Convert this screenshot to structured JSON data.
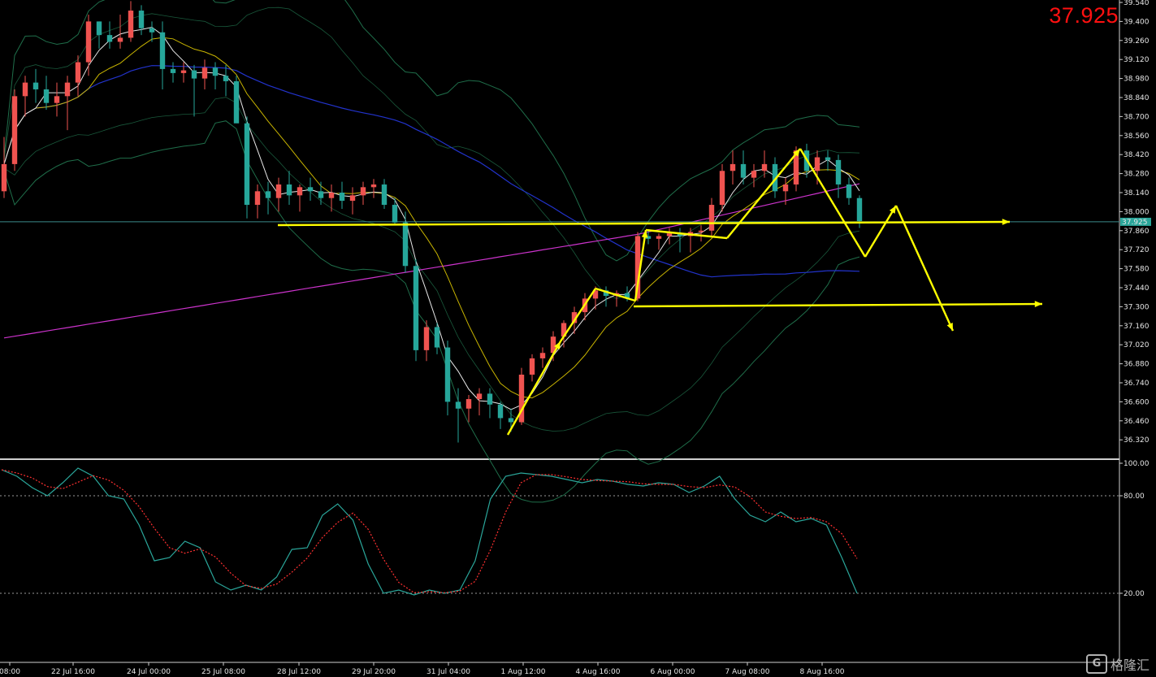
{
  "current_price": "37.925",
  "price_tag": "37.925",
  "watermark_text": "格隆汇",
  "watermark_logo": "G",
  "colors": {
    "bull": "#ef5350",
    "bear": "#26a69a",
    "annotation": "#ffff00",
    "bollinger": "#1f6e4a",
    "ma_fast": "#e8e8e8",
    "ma_slow": "#c8b400",
    "ma_blue": "#2233cc",
    "ma_magenta": "#cc33cc",
    "stoch_k": "#2aa69a",
    "stoch_d": "#ff3030"
  },
  "chart_data": [
    {
      "type": "candlestick",
      "y_ticks": [
        "39.540",
        "39.400",
        "39.260",
        "39.120",
        "38.980",
        "38.840",
        "38.700",
        "38.560",
        "38.420",
        "38.280",
        "38.140",
        "38.000",
        "37.860",
        "37.720",
        "37.580",
        "37.440",
        "37.300",
        "37.160",
        "37.020",
        "36.880",
        "36.740",
        "36.600",
        "36.460",
        "36.320"
      ],
      "ylim": [
        36.2,
        39.55
      ],
      "x_ticks": [
        "08:00",
        "22 Jul 16:00",
        "24 Jul 00:00",
        "25 Jul 08:00",
        "28 Jul 12:00",
        "29 Jul 20:00",
        "31 Jul 04:00",
        "1 Aug 12:00",
        "4 Aug 16:00",
        "6 Aug 00:00",
        "7 Aug 08:00",
        "8 Aug 16:00"
      ],
      "ohlc": [
        [
          38.15,
          38.55,
          38.1,
          38.35
        ],
        [
          38.35,
          38.9,
          38.3,
          38.85
        ],
        [
          38.85,
          39.0,
          38.7,
          38.95
        ],
        [
          38.95,
          39.05,
          38.8,
          38.9
        ],
        [
          38.9,
          39.0,
          38.75,
          38.8
        ],
        [
          38.8,
          38.95,
          38.7,
          38.85
        ],
        [
          38.85,
          39.0,
          38.6,
          38.95
        ],
        [
          38.95,
          39.15,
          38.85,
          39.1
        ],
        [
          39.1,
          39.45,
          39.0,
          39.4
        ],
        [
          39.4,
          39.4,
          39.2,
          39.3
        ],
        [
          39.3,
          39.4,
          39.2,
          39.25
        ],
        [
          39.25,
          39.45,
          39.2,
          39.28
        ],
        [
          39.28,
          39.55,
          39.25,
          39.48
        ],
        [
          39.48,
          39.52,
          39.3,
          39.35
        ],
        [
          39.35,
          39.4,
          39.25,
          39.32
        ],
        [
          39.32,
          39.4,
          38.9,
          39.05
        ],
        [
          39.05,
          39.1,
          38.95,
          39.02
        ],
        [
          39.02,
          39.1,
          38.95,
          39.04
        ],
        [
          39.04,
          39.08,
          38.7,
          38.98
        ],
        [
          38.98,
          39.12,
          38.9,
          39.06
        ],
        [
          39.06,
          39.1,
          38.9,
          39.0
        ],
        [
          39.0,
          39.08,
          38.85,
          38.96
        ],
        [
          38.96,
          39.0,
          38.7,
          38.65
        ],
        [
          38.65,
          38.7,
          37.95,
          38.05
        ],
        [
          38.05,
          38.2,
          37.95,
          38.15
        ],
        [
          38.15,
          38.22,
          37.98,
          38.1
        ],
        [
          38.1,
          38.25,
          38.0,
          38.2
        ],
        [
          38.2,
          38.3,
          38.05,
          38.12
        ],
        [
          38.12,
          38.2,
          38.0,
          38.18
        ],
        [
          38.18,
          38.25,
          38.08,
          38.15
        ],
        [
          38.15,
          38.22,
          38.05,
          38.1
        ],
        [
          38.1,
          38.2,
          38.0,
          38.14
        ],
        [
          38.14,
          38.22,
          38.02,
          38.08
        ],
        [
          38.08,
          38.18,
          37.98,
          38.12
        ],
        [
          38.12,
          38.22,
          38.05,
          38.18
        ],
        [
          38.18,
          38.24,
          38.1,
          38.2
        ],
        [
          38.2,
          38.24,
          38.02,
          38.05
        ],
        [
          38.05,
          38.1,
          37.9,
          37.92
        ],
        [
          37.92,
          38.0,
          37.55,
          37.6
        ],
        [
          37.6,
          37.65,
          36.9,
          36.98
        ],
        [
          36.98,
          37.2,
          36.9,
          37.15
        ],
        [
          37.15,
          37.18,
          36.95,
          37.0
        ],
        [
          37.0,
          37.05,
          36.5,
          36.6
        ],
        [
          36.6,
          36.7,
          36.3,
          36.55
        ],
        [
          36.55,
          36.65,
          36.45,
          36.62
        ],
        [
          36.62,
          36.7,
          36.5,
          36.66
        ],
        [
          36.66,
          36.7,
          36.48,
          36.58
        ],
        [
          36.58,
          36.6,
          36.4,
          36.48
        ],
        [
          36.48,
          36.55,
          36.38,
          36.45
        ],
        [
          36.45,
          36.85,
          36.43,
          36.8
        ],
        [
          36.8,
          36.95,
          36.75,
          36.92
        ],
        [
          36.92,
          37.0,
          36.85,
          36.96
        ],
        [
          36.96,
          37.12,
          36.9,
          37.08
        ],
        [
          37.08,
          37.2,
          37.0,
          37.18
        ],
        [
          37.18,
          37.3,
          37.1,
          37.26
        ],
        [
          37.26,
          37.4,
          37.2,
          37.36
        ],
        [
          37.36,
          37.45,
          37.28,
          37.42
        ],
        [
          37.42,
          37.45,
          37.3,
          37.38
        ],
        [
          37.38,
          37.42,
          37.3,
          37.4
        ],
        [
          37.4,
          37.45,
          37.34,
          37.36
        ],
        [
          37.36,
          37.85,
          37.34,
          37.82
        ],
        [
          37.82,
          37.86,
          37.76,
          37.8
        ],
        [
          37.8,
          37.84,
          37.72,
          37.82
        ],
        [
          37.82,
          37.88,
          37.76,
          37.84
        ],
        [
          37.84,
          37.88,
          37.7,
          37.82
        ],
        [
          37.82,
          37.88,
          37.7,
          37.85
        ],
        [
          37.85,
          37.9,
          37.78,
          37.86
        ],
        [
          37.86,
          38.1,
          37.82,
          38.05
        ],
        [
          38.05,
          38.35,
          38.0,
          38.3
        ],
        [
          38.3,
          38.45,
          38.2,
          38.35
        ],
        [
          38.35,
          38.45,
          38.2,
          38.25
        ],
        [
          38.25,
          38.35,
          38.18,
          38.3
        ],
        [
          38.3,
          38.45,
          38.25,
          38.35
        ],
        [
          38.35,
          38.4,
          38.1,
          38.15
        ],
        [
          38.15,
          38.25,
          38.05,
          38.2
        ],
        [
          38.2,
          38.48,
          38.15,
          38.45
        ],
        [
          38.45,
          38.5,
          38.25,
          38.3
        ],
        [
          38.3,
          38.45,
          38.2,
          38.4
        ],
        [
          38.4,
          38.45,
          38.3,
          38.38
        ],
        [
          38.38,
          38.42,
          38.1,
          38.2
        ],
        [
          38.2,
          38.25,
          38.05,
          38.1
        ],
        [
          38.1,
          38.12,
          37.88,
          37.93
        ]
      ]
    },
    {
      "type": "line",
      "series": [
        {
          "values": [
            96,
            92,
            85,
            80,
            88,
            97,
            92,
            80,
            78,
            62,
            40,
            42,
            52,
            48,
            27,
            22,
            25,
            22,
            30,
            47,
            48,
            68,
            75,
            65,
            38,
            20,
            22,
            19,
            22,
            20,
            22,
            40,
            78,
            92,
            94,
            93,
            92,
            90,
            88,
            90,
            89,
            87,
            86,
            88,
            87,
            82,
            86,
            92,
            78,
            68,
            64,
            70,
            64,
            66,
            62,
            42,
            20
          ]
        }
      ],
      "ylim": [
        0,
        100
      ],
      "y_ticks": [
        "100.00",
        "80.00",
        "20.00"
      ]
    }
  ]
}
